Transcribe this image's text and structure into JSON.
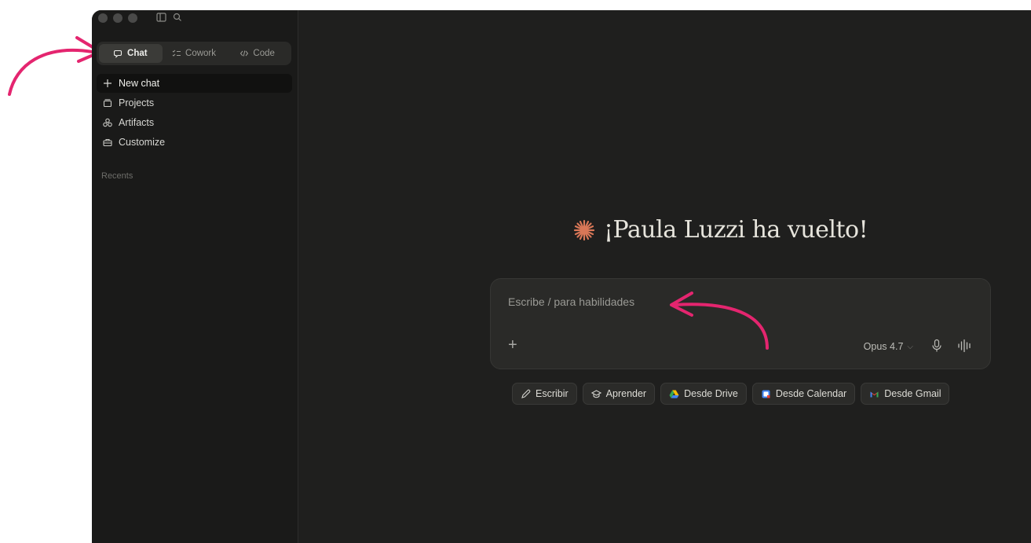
{
  "sidebar": {
    "modes": [
      {
        "label": "Chat",
        "icon": "chat-bubble-icon",
        "active": true
      },
      {
        "label": "Cowork",
        "icon": "task-list-icon",
        "active": false
      },
      {
        "label": "Code",
        "icon": "code-brackets-icon",
        "active": false
      }
    ],
    "nav": [
      {
        "label": "New chat",
        "icon": "plus-icon"
      },
      {
        "label": "Projects",
        "icon": "folder-icon"
      },
      {
        "label": "Artifacts",
        "icon": "artifacts-icon"
      },
      {
        "label": "Customize",
        "icon": "briefcase-icon"
      }
    ],
    "recents_label": "Recents"
  },
  "main": {
    "greeting": "¡Paula Luzzi ha vuelto!",
    "composer": {
      "placeholder": "Escribe / para habilidades",
      "model": "Opus 4.7"
    },
    "chips": [
      {
        "label": "Escribir",
        "icon": "pencil-icon"
      },
      {
        "label": "Aprender",
        "icon": "graduation-cap-icon"
      },
      {
        "label": "Desde Drive",
        "icon": "google-drive-icon"
      },
      {
        "label": "Desde Calendar",
        "icon": "google-calendar-icon"
      },
      {
        "label": "Desde Gmail",
        "icon": "gmail-icon"
      }
    ]
  },
  "colors": {
    "accent": "#d97757",
    "annotation": "#e4256f",
    "background": "#1f1f1e",
    "sidebar": "#1a1a19"
  }
}
